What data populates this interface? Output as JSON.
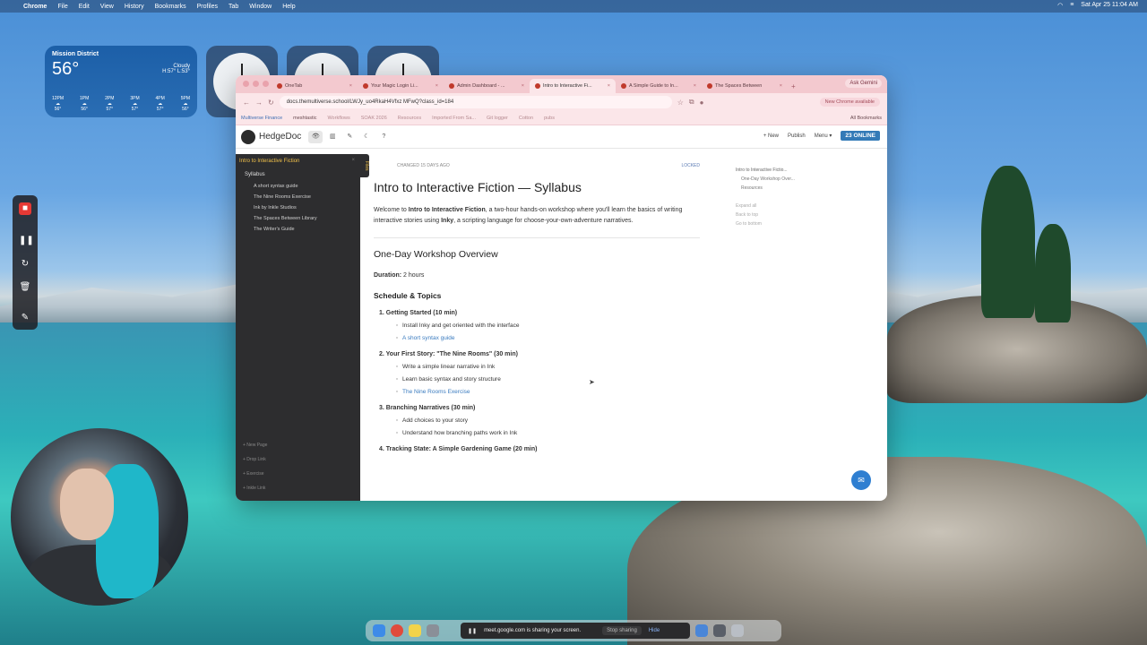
{
  "menubar": {
    "app": "Chrome",
    "items": [
      "File",
      "Edit",
      "View",
      "History",
      "Bookmarks",
      "Profiles",
      "Tab",
      "Window",
      "Help"
    ],
    "datetime": "Sat Apr 25  11:04 AM"
  },
  "weather": {
    "location": "Mission District",
    "temp": "56°",
    "condition": "Cloudy",
    "hilo": "H:57° L:53°",
    "hours": [
      {
        "t": "12PM",
        "v": "56°"
      },
      {
        "t": "1PM",
        "v": "56°"
      },
      {
        "t": "2PM",
        "v": "57°"
      },
      {
        "t": "3PM",
        "v": "57°"
      },
      {
        "t": "4PM",
        "v": "57°"
      },
      {
        "t": "5PM",
        "v": "56°"
      }
    ]
  },
  "browser": {
    "tabs": [
      {
        "label": "OneTab",
        "active": false
      },
      {
        "label": "Your Magic Login Li...",
        "active": false
      },
      {
        "label": "Admin Dashboard - ...",
        "active": false
      },
      {
        "label": "Intro to Interactive Fi...",
        "active": true
      },
      {
        "label": "A Simple Guide to In...",
        "active": false
      },
      {
        "label": "The Spaces Between",
        "active": false
      }
    ],
    "gemini": "Ask Gemini",
    "url": "docs.themultiverse.school/LWJy_uo4RkaH4Vfxz MFwQ?class_id=184",
    "update": "New Chrome available",
    "bookmarks": [
      "Multiverse Finance",
      "meshtastic",
      "Workflows",
      "SOAK 2026",
      "Resources",
      "Imported From Sa...",
      "Git logger",
      "Cotton",
      "pubs"
    ],
    "all_bookmarks": "All Bookmarks"
  },
  "hedgedoc": {
    "name": "HedgeDoc",
    "new": "+ New",
    "publish": "Publish",
    "menu": "Menu ▾",
    "online": "23 ONLINE"
  },
  "sidebar": {
    "title": "Intro to Interactive Fiction",
    "folder": "Syllabus",
    "items": [
      "A short syntax guide",
      "The Nine Rooms Exercise",
      "Ink by Inkle Studios",
      "The Spaces Between Library",
      "The Writer's Guide"
    ],
    "bottom": [
      "+ New Page",
      "+ Drop Link",
      "+ Exercise",
      "+ Inkle Link"
    ],
    "badge": "Files"
  },
  "doc": {
    "changed": "CHANGED 15 DAYS AGO",
    "locked": "LOCKED",
    "title": "Intro to Interactive Fiction — Syllabus",
    "intro_1": "Welcome to ",
    "intro_b1": "Intro to Interactive Fiction",
    "intro_2": ", a two-hour hands-on workshop where you'll learn the basics of writing interactive stories using ",
    "intro_b2": "Inky",
    "intro_3": ", a scripting language for choose-your-own-adventure narratives.",
    "h2": "One-Day Workshop Overview",
    "duration_label": "Duration:",
    "duration": " 2 hours",
    "h3": "Schedule & Topics",
    "sections": [
      {
        "title": "1.  Getting Started (10 min)",
        "items": [
          {
            "text": "Install Inky and get oriented with the interface",
            "link": false
          },
          {
            "text": "A short syntax guide",
            "link": true
          }
        ]
      },
      {
        "title": "2.  Your First Story: \"The Nine Rooms\" (30 min)",
        "items": [
          {
            "text": "Write a simple linear narrative in Ink",
            "link": false
          },
          {
            "text": "Learn basic syntax and story structure",
            "link": false
          },
          {
            "text": "The Nine Rooms Exercise",
            "link": true
          }
        ]
      },
      {
        "title": "3.  Branching Narratives (30 min)",
        "items": [
          {
            "text": "Add choices to your story",
            "link": false
          },
          {
            "text": "Understand how branching paths work in Ink",
            "link": false
          }
        ]
      },
      {
        "title": "4.  Tracking State: A Simple Gardening Game (20 min)",
        "items": []
      }
    ]
  },
  "toc": {
    "title": "Intro to Interactive Fictio...",
    "sub1": "One-Day Workshop Over...",
    "sub2": "Resources",
    "expand": "Expand all",
    "back_top": "Back to top",
    "bottom": "Go to bottom"
  },
  "share": {
    "text": "meet.google.com is sharing your screen.",
    "stop": "Stop sharing",
    "hide": "Hide"
  }
}
